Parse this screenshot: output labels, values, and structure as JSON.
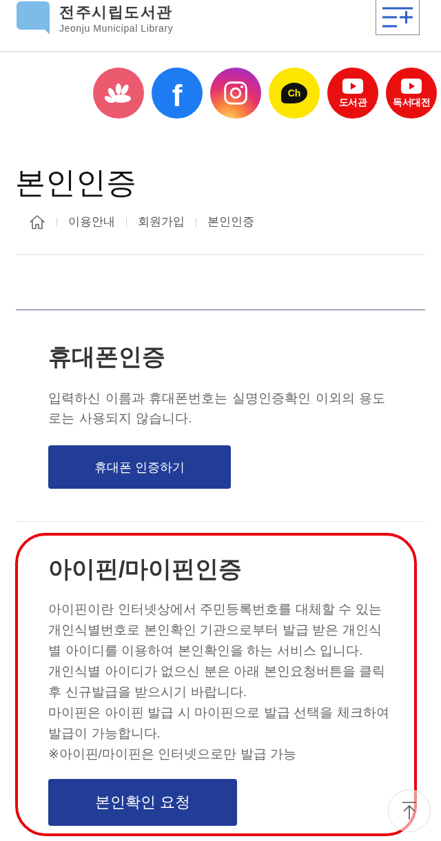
{
  "header": {
    "logo_title": "전주시립도서관",
    "logo_subtitle": "Jeonju Municipal Library"
  },
  "social_links": [
    {
      "kind": "blog"
    },
    {
      "kind": "facebook",
      "label": "f"
    },
    {
      "kind": "instagram"
    },
    {
      "kind": "channel",
      "label": "Ch"
    },
    {
      "kind": "video",
      "label": "도서관"
    },
    {
      "kind": "video",
      "label": "독서대전"
    }
  ],
  "page_title": "본인인증",
  "breadcrumb": [
    "이용안내",
    "회원가입",
    "본인인증"
  ],
  "sections": [
    {
      "title": "휴대폰인증",
      "paragraphs": [
        "입력하신 이름과 휴대폰번호는 실명인증확인 이외의 용도로는 사용되지 않습니다."
      ],
      "button": "휴대폰 인증하기",
      "highlighted": false
    },
    {
      "title": "아이핀/마이핀인증",
      "paragraphs": [
        "아이핀이란 인터넷상에서 주민등록번호를 대체할 수 있는 개인식별번호로 본인확인 기관으로부터 발급 받은 개인식별 아이디를 이용하여 본인확인을 하는 서비스 입니다.",
        "개인식별 아이디가 없으신 분은 아래 본인요청버튼을 클릭 후 신규발급을 받으시기 바랍니다.",
        "마이핀은 아이핀 발급 시 마이핀으로 발급 선택을 체크하여 발급이 가능합니다.",
        "※아이핀/마이핀은 인터넷으로만 발급 가능"
      ],
      "button": "본인확인 요청",
      "highlighted": true
    }
  ]
}
